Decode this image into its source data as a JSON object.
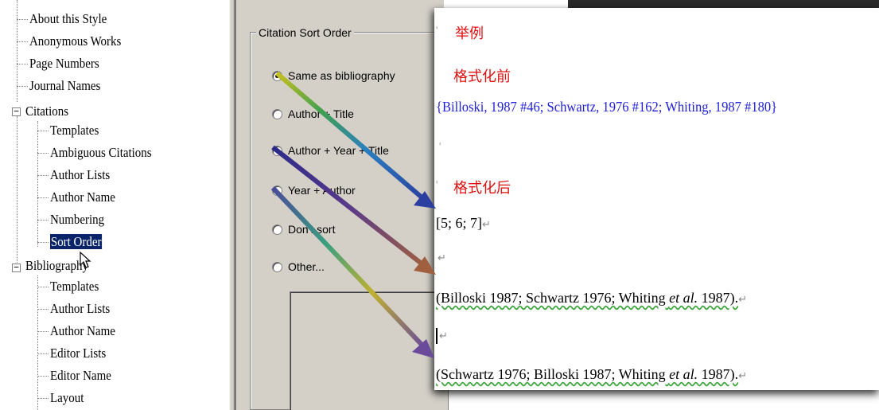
{
  "tree": {
    "items": [
      {
        "label": "About this Style",
        "level": 1
      },
      {
        "label": "Anonymous Works",
        "level": 1
      },
      {
        "label": "Page Numbers",
        "level": 1
      },
      {
        "label": "Journal Names",
        "level": 1
      },
      {
        "label": "Citations",
        "level": 0,
        "expanded": true
      },
      {
        "label": "Templates",
        "level": 2
      },
      {
        "label": "Ambiguous Citations",
        "level": 2
      },
      {
        "label": "Author Lists",
        "level": 2
      },
      {
        "label": "Author Name",
        "level": 2
      },
      {
        "label": "Numbering",
        "level": 2
      },
      {
        "label": "Sort Order",
        "level": 2,
        "selected": true
      },
      {
        "label": "Bibliography",
        "level": 0,
        "expanded": true
      },
      {
        "label": "Templates",
        "level": 2
      },
      {
        "label": "Author Lists",
        "level": 2
      },
      {
        "label": "Author Name",
        "level": 2
      },
      {
        "label": "Editor Lists",
        "level": 2
      },
      {
        "label": "Editor Name",
        "level": 2
      },
      {
        "label": "Layout",
        "level": 2
      }
    ],
    "expander_symbol": "−"
  },
  "panel": {
    "group_title": "Citation Sort Order",
    "options": [
      {
        "label": "Same as bibliography",
        "selected": true
      },
      {
        "label": "Author + Title",
        "selected": false
      },
      {
        "label": "Author + Year + Title",
        "selected": false
      },
      {
        "label": "Year + Author",
        "selected": false
      },
      {
        "label": "Don't sort",
        "selected": false
      },
      {
        "label": "Other...",
        "selected": false
      }
    ]
  },
  "doc": {
    "example_label": "举例",
    "before_label": "格式化前",
    "before_citation": "{Billoski, 1987 #46; Schwartz, 1976 #162; Whiting, 1987 #180}",
    "after_label": "格式化后",
    "numbered_result": "[5; 6; 7]",
    "author_year_result": "(Billoski 1987; Schwartz 1976; Whiting ",
    "year_author_result": "(Schwartz 1976; Billoski 1987; Whiting ",
    "et_al": "et al.",
    "year_suffix": " 1987).",
    "para_mark": "↵",
    "stray_mark": "'"
  },
  "colors": {
    "selection": "#0a246a",
    "dialog_bg": "#d4d0c8",
    "label_red": "#e01010",
    "citation_blue": "#1f1fdd",
    "spell_underline": "#3da63d"
  }
}
